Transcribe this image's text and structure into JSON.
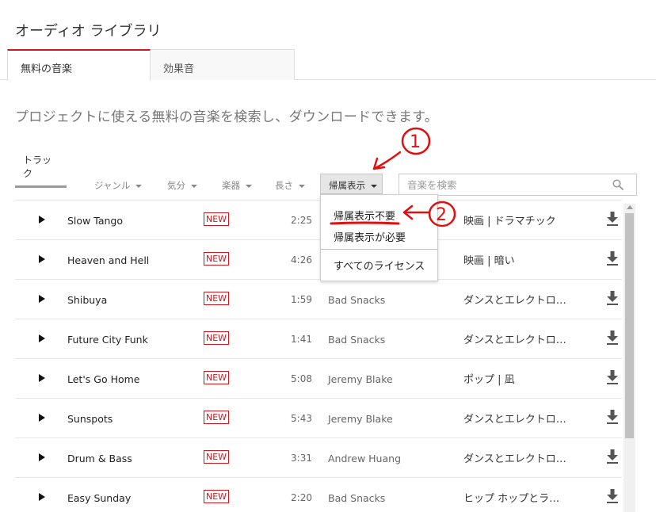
{
  "page": {
    "title": "オーディオ ライブラリ"
  },
  "tabs": [
    {
      "label": "無料の音楽",
      "active": true
    },
    {
      "label": "効果音",
      "active": false
    }
  ],
  "intro": "プロジェクトに使える無料の音楽を検索し、ダウンロードできます。",
  "subtab": {
    "label": "トラック"
  },
  "filters": {
    "genre": "ジャンル",
    "mood": "気分",
    "instrument": "楽器",
    "length": "長さ",
    "attribution": "帰属表示"
  },
  "search": {
    "placeholder": "音楽を検索"
  },
  "tracks": [
    {
      "title": "Slow Tango",
      "badge": "NEW",
      "duration": "2:25",
      "artist": "",
      "genre": "映画 | ドラマチック"
    },
    {
      "title": "Heaven and Hell",
      "badge": "NEW",
      "duration": "4:26",
      "artist": "",
      "genre": "映画 | 暗い"
    },
    {
      "title": "Shibuya",
      "badge": "NEW",
      "duration": "1:59",
      "artist": "Bad Snacks",
      "genre": "ダンスとエレクトロ…"
    },
    {
      "title": "Future City Funk",
      "badge": "NEW",
      "duration": "1:41",
      "artist": "Bad Snacks",
      "genre": "ダンスとエレクトロ…"
    },
    {
      "title": "Let's Go Home",
      "badge": "NEW",
      "duration": "5:08",
      "artist": "Jeremy Blake",
      "genre": "ポップ | 凪"
    },
    {
      "title": "Sunspots",
      "badge": "NEW",
      "duration": "5:43",
      "artist": "Jeremy Blake",
      "genre": "ダンスとエレクトロ…"
    },
    {
      "title": "Drum & Bass",
      "badge": "NEW",
      "duration": "3:31",
      "artist": "Andrew Huang",
      "genre": "ダンスとエレクトロ…"
    },
    {
      "title": "Easy Sunday",
      "badge": "NEW",
      "duration": "2:20",
      "artist": "Bad Snacks",
      "genre": "ヒップ ホップとラ…"
    }
  ],
  "dropdown": {
    "items": [
      "帰属表示不要",
      "帰属表示が必要",
      "すべてのライセンス"
    ]
  },
  "icons": {
    "play": "play-icon",
    "download": "download-icon",
    "search": "search-icon",
    "dropdown": "caret-down-icon"
  },
  "colors": {
    "accent": "#cc181e",
    "annotation": "#e01010"
  }
}
